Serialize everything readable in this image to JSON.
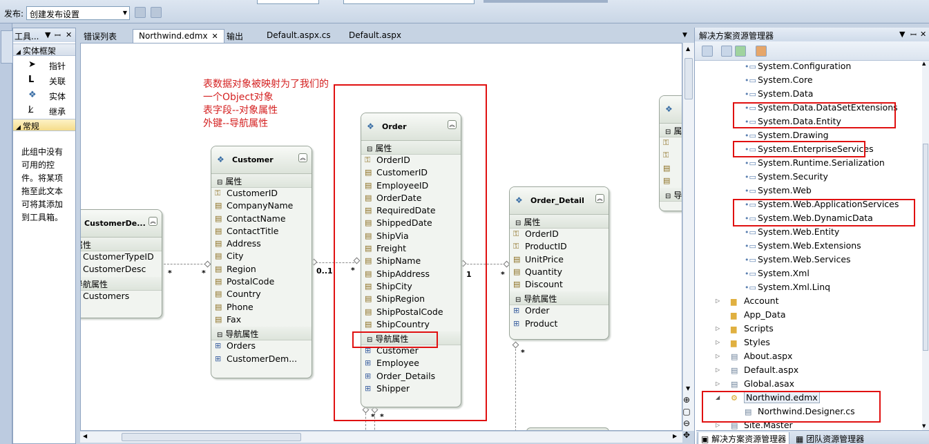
{
  "toolbar": {
    "publish_label": "发布:",
    "publish_value": "创建发布设置"
  },
  "toolbox": {
    "title": "工具...",
    "groups": [
      {
        "label": "实体框架"
      },
      {
        "label": "常规"
      }
    ],
    "items": [
      {
        "label": "指针",
        "icon": "pointer-icon"
      },
      {
        "label": "关联",
        "icon": "association-icon"
      },
      {
        "label": "实体",
        "icon": "entity-icon"
      },
      {
        "label": "继承",
        "icon": "inheritance-icon"
      }
    ],
    "empty_message": "此组中没有可用的控件。将某项拖至此文本可将其添加到工具箱。"
  },
  "tabs": [
    {
      "label": "错误列表"
    },
    {
      "label": "Northwind.edmx",
      "active": true
    },
    {
      "label": "输出"
    },
    {
      "label": "Default.aspx.cs"
    },
    {
      "label": "Default.aspx"
    }
  ],
  "annotation": {
    "lines": [
      "表数据对象被映射为了我们的",
      "一个Object对象",
      "表字段--对象属性",
      "外键--导航属性"
    ],
    "color": "#d42020"
  },
  "entities": {
    "customer_demo": {
      "title": "CustomerDe...",
      "section_props": "属性",
      "props": [
        "CustomerTypeID",
        "CustomerDesc"
      ],
      "section_nav": "导航属性",
      "nav": [
        "Customers"
      ]
    },
    "customer": {
      "title": "Customer",
      "section_props": "属性",
      "props": [
        "CustomerID",
        "CompanyName",
        "ContactName",
        "ContactTitle",
        "Address",
        "City",
        "Region",
        "PostalCode",
        "Country",
        "Phone",
        "Fax"
      ],
      "section_nav": "导航属性",
      "nav": [
        "Orders",
        "CustomerDem..."
      ]
    },
    "order": {
      "title": "Order",
      "section_props": "属性",
      "props": [
        "OrderID",
        "CustomerID",
        "EmployeeID",
        "OrderDate",
        "RequiredDate",
        "ShippedDate",
        "ShipVia",
        "Freight",
        "ShipName",
        "ShipAddress",
        "ShipCity",
        "ShipRegion",
        "ShipPostalCode",
        "ShipCountry"
      ],
      "section_nav": "导航属性",
      "nav": [
        "Customer",
        "Employee",
        "Order_Details",
        "Shipper"
      ]
    },
    "order_detail": {
      "title": "Order_Detail",
      "section_props": "属性",
      "props": [
        "OrderID",
        "ProductID",
        "UnitPrice",
        "Quantity",
        "Discount"
      ],
      "section_nav": "导航属性",
      "nav": [
        "Order",
        "Product"
      ]
    },
    "partial_right": {
      "section_props": "属",
      "section_nav": "导"
    }
  },
  "relations": {
    "cd_left": "*",
    "cd_right": "*",
    "co_left": "0..1",
    "co_right": "*",
    "od_left": "1",
    "od_right": "*",
    "od_bottom": "*",
    "order_bottom_1": "*",
    "order_bottom_2": "*"
  },
  "solution_explorer": {
    "title": "解决方案资源管理器",
    "references": [
      "System.Configuration",
      "System.Core",
      "System.Data",
      "System.Data.DataSetExtensions",
      "System.Data.Entity",
      "System.Drawing",
      "System.EnterpriseServices",
      "System.Runtime.Serialization",
      "System.Security",
      "System.Web",
      "System.Web.ApplicationServices",
      "System.Web.DynamicData",
      "System.Web.Entity",
      "System.Web.Extensions",
      "System.Web.Services",
      "System.Xml",
      "System.Xml.Linq"
    ],
    "folders": [
      "Account",
      "App_Data",
      "Scripts",
      "Styles"
    ],
    "files": [
      "About.aspx",
      "Default.aspx",
      "Global.asax"
    ],
    "edmx": "Northwind.edmx",
    "edmx_child": "Northwind.Designer.cs",
    "site_master": "Site.Master",
    "bottom_tabs": [
      "解决方案资源管理器",
      "团队资源管理器"
    ]
  }
}
